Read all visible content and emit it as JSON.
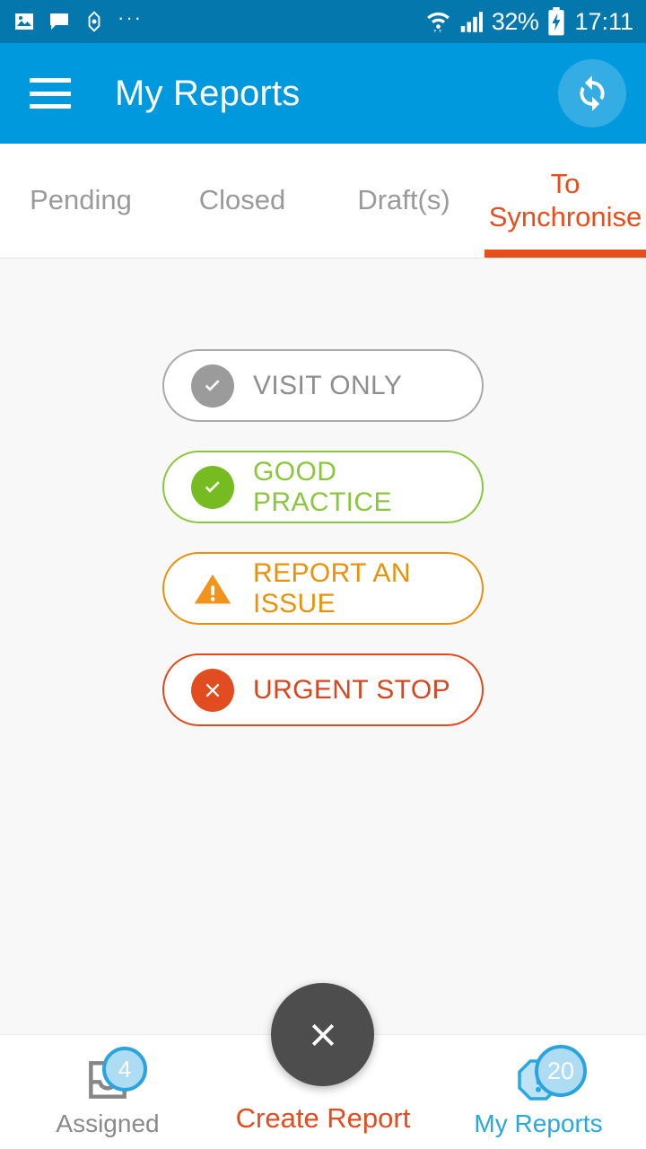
{
  "status_bar": {
    "icons": [
      "image-icon",
      "message-icon",
      "navigation-diamond-icon",
      "more-dots-icon"
    ],
    "wifi_icon": "wifi-icon",
    "signal_icon": "cellular-signal-icon",
    "battery_percent": "32%",
    "battery_icon": "battery-charging-icon",
    "time": "17:11",
    "background": "#0477AD"
  },
  "app_bar": {
    "menu_icon": "hamburger-menu-icon",
    "title": "My Reports",
    "sync_icon": "sync-icon",
    "background": "#0099DE"
  },
  "tabs": {
    "items": [
      {
        "label": "Pending",
        "active": false
      },
      {
        "label": "Closed",
        "active": false
      },
      {
        "label": "Draft(s)",
        "active": false
      },
      {
        "label": "To Synchronise",
        "active": true
      }
    ],
    "active_color": "#E84E1B",
    "inactive_color": "#9A9A9A"
  },
  "actions": [
    {
      "label": "VISIT ONLY",
      "icon": "check-circle-icon",
      "color": "#8E8E8E",
      "border": "#AAAAAA",
      "icon_bg": "#9B9B9B"
    },
    {
      "label": "GOOD PRACTICE",
      "icon": "check-circle-icon",
      "color": "#8CC63E",
      "border": "#8CC63E",
      "icon_bg": "#76BC21"
    },
    {
      "label": "REPORT AN ISSUE",
      "icon": "warning-triangle-icon",
      "color": "#E8920B",
      "border": "#E8920B",
      "icon_bg": "#F0941C"
    },
    {
      "label": "URGENT STOP",
      "icon": "x-circle-icon",
      "color": "#D9451C",
      "border": "#E1481E",
      "icon_bg": "#E14D20"
    }
  ],
  "fab": {
    "icon": "close-x-icon",
    "background": "#4D4D4D"
  },
  "bottom_nav": {
    "items": [
      {
        "label": "Assigned",
        "icon": "inbox-tray-icon",
        "badge": "4",
        "active": false
      },
      {
        "label": "Create Report",
        "icon": "",
        "badge": "",
        "active": false
      },
      {
        "label": "My Reports",
        "icon": "alert-octagon-icon",
        "badge": "20",
        "active": true
      }
    ],
    "active_color": "#29A8DF",
    "create_color": "#E14D20",
    "badge_fill": "#AEDCF2",
    "badge_ring": "#2BA3DC"
  }
}
